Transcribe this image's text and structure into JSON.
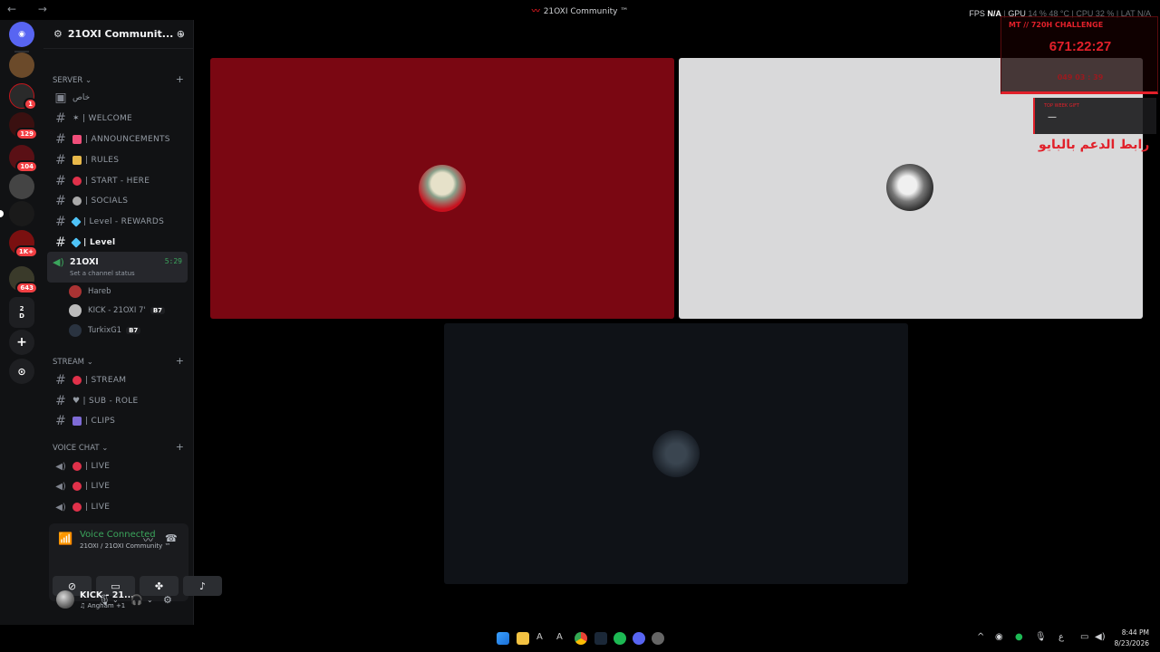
{
  "window": {
    "title": "21OXI Community ™",
    "stats": {
      "fps_label": "FPS",
      "fps_value": "N/A",
      "gpu_label": "GPU",
      "gpu_value": "14 % 48 °C",
      "cpu_label": "CPU",
      "cpu_value": "32 %",
      "lat_label": "LAT",
      "lat_value": "N/A"
    }
  },
  "rail": {
    "badges": [
      "1",
      "129",
      "104",
      "1K+",
      "643"
    ],
    "folder_text": [
      "2",
      "D"
    ]
  },
  "server": {
    "name": "21OXI Communit...",
    "categories": {
      "server": "SERVER",
      "stream": "STREAM",
      "voice": "VOICE CHAT"
    },
    "private_channel": "خاص",
    "channels": [
      {
        "label": "✶ | WELCOME"
      },
      {
        "label": "| ANNOUNCEMENTS"
      },
      {
        "label": "| RULES"
      },
      {
        "label": "| START - HERE"
      },
      {
        "label": "| SOCIALS"
      },
      {
        "label": "| Level - REWARDS"
      },
      {
        "label": "| Level"
      }
    ],
    "voice_channel": {
      "name": "21OXI",
      "status": "Set a channel status",
      "time": "5:29"
    },
    "members": [
      {
        "name": "Hareb",
        "tag": ""
      },
      {
        "name": "KICK - 21OXI 7'",
        "tag": "B7"
      },
      {
        "name": "TurkixG1",
        "tag": "B7"
      }
    ],
    "stream_channels": [
      {
        "label": "| STREAM"
      },
      {
        "label": "♥ | SUB - ROLE"
      },
      {
        "label": "| CLIPS"
      }
    ],
    "voice_chats": [
      {
        "label": "| LIVE"
      },
      {
        "label": "| LIVE"
      },
      {
        "label": "| LIVE"
      }
    ]
  },
  "voice_panel": {
    "status": "Voice Connected",
    "location": "21OXI / 21OXI Community ™"
  },
  "user": {
    "name": "KICK - 21...",
    "activity": "♫ Angham +1"
  },
  "overlay": {
    "challenge_title": "MT // 720H CHALLENGE",
    "timer": "671:22:27",
    "sub_timer": "049 03 : 39",
    "widget_header": "TOP WEEK GIFT",
    "widget_value": "—",
    "support_text": "رابط الدعم بالبايو"
  },
  "taskbar": {
    "time": "8:44 PM",
    "date": "8/23/2026",
    "lang": "ع"
  },
  "colors": {
    "tile1": "#7a0712",
    "tile2": "#d9d9da",
    "tile3": "#0f1217",
    "accent_red": "#e1202a",
    "green": "#3ba55c"
  }
}
